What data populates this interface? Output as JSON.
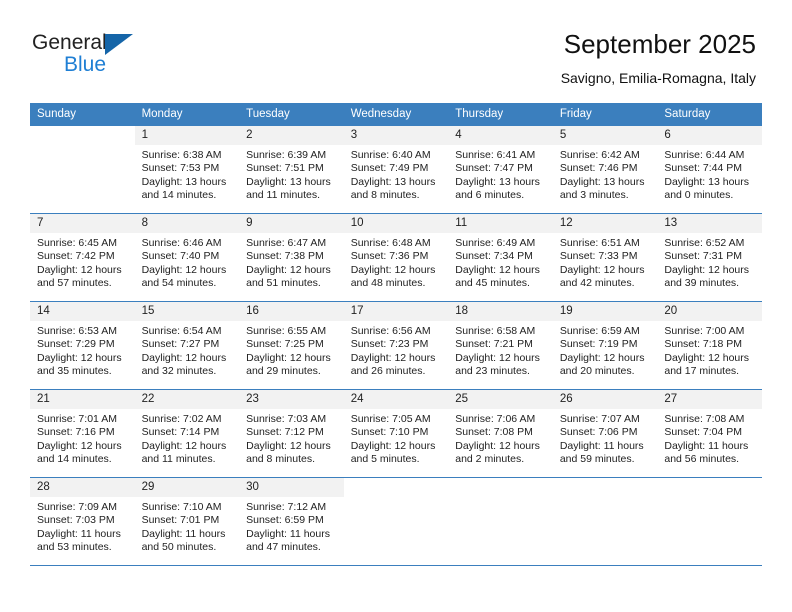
{
  "brand": {
    "name_part1": "General",
    "name_part2": "Blue",
    "triangle_icon": "triangle-icon",
    "accent_blue": "#1f7fd4",
    "header_blue": "#3b7fbe"
  },
  "header": {
    "title": "September 2025",
    "subtitle": "Savigno, Emilia-Romagna, Italy"
  },
  "weekday_headers": [
    "Sunday",
    "Monday",
    "Tuesday",
    "Wednesday",
    "Thursday",
    "Friday",
    "Saturday"
  ],
  "weeks": [
    [
      {
        "day": "",
        "empty": true
      },
      {
        "day": "1",
        "sunrise": "Sunrise: 6:38 AM",
        "sunset": "Sunset: 7:53 PM",
        "daylight": "Daylight: 13 hours and 14 minutes."
      },
      {
        "day": "2",
        "sunrise": "Sunrise: 6:39 AM",
        "sunset": "Sunset: 7:51 PM",
        "daylight": "Daylight: 13 hours and 11 minutes."
      },
      {
        "day": "3",
        "sunrise": "Sunrise: 6:40 AM",
        "sunset": "Sunset: 7:49 PM",
        "daylight": "Daylight: 13 hours and 8 minutes."
      },
      {
        "day": "4",
        "sunrise": "Sunrise: 6:41 AM",
        "sunset": "Sunset: 7:47 PM",
        "daylight": "Daylight: 13 hours and 6 minutes."
      },
      {
        "day": "5",
        "sunrise": "Sunrise: 6:42 AM",
        "sunset": "Sunset: 7:46 PM",
        "daylight": "Daylight: 13 hours and 3 minutes."
      },
      {
        "day": "6",
        "sunrise": "Sunrise: 6:44 AM",
        "sunset": "Sunset: 7:44 PM",
        "daylight": "Daylight: 13 hours and 0 minutes."
      }
    ],
    [
      {
        "day": "7",
        "sunrise": "Sunrise: 6:45 AM",
        "sunset": "Sunset: 7:42 PM",
        "daylight": "Daylight: 12 hours and 57 minutes."
      },
      {
        "day": "8",
        "sunrise": "Sunrise: 6:46 AM",
        "sunset": "Sunset: 7:40 PM",
        "daylight": "Daylight: 12 hours and 54 minutes."
      },
      {
        "day": "9",
        "sunrise": "Sunrise: 6:47 AM",
        "sunset": "Sunset: 7:38 PM",
        "daylight": "Daylight: 12 hours and 51 minutes."
      },
      {
        "day": "10",
        "sunrise": "Sunrise: 6:48 AM",
        "sunset": "Sunset: 7:36 PM",
        "daylight": "Daylight: 12 hours and 48 minutes."
      },
      {
        "day": "11",
        "sunrise": "Sunrise: 6:49 AM",
        "sunset": "Sunset: 7:34 PM",
        "daylight": "Daylight: 12 hours and 45 minutes."
      },
      {
        "day": "12",
        "sunrise": "Sunrise: 6:51 AM",
        "sunset": "Sunset: 7:33 PM",
        "daylight": "Daylight: 12 hours and 42 minutes."
      },
      {
        "day": "13",
        "sunrise": "Sunrise: 6:52 AM",
        "sunset": "Sunset: 7:31 PM",
        "daylight": "Daylight: 12 hours and 39 minutes."
      }
    ],
    [
      {
        "day": "14",
        "sunrise": "Sunrise: 6:53 AM",
        "sunset": "Sunset: 7:29 PM",
        "daylight": "Daylight: 12 hours and 35 minutes."
      },
      {
        "day": "15",
        "sunrise": "Sunrise: 6:54 AM",
        "sunset": "Sunset: 7:27 PM",
        "daylight": "Daylight: 12 hours and 32 minutes."
      },
      {
        "day": "16",
        "sunrise": "Sunrise: 6:55 AM",
        "sunset": "Sunset: 7:25 PM",
        "daylight": "Daylight: 12 hours and 29 minutes."
      },
      {
        "day": "17",
        "sunrise": "Sunrise: 6:56 AM",
        "sunset": "Sunset: 7:23 PM",
        "daylight": "Daylight: 12 hours and 26 minutes."
      },
      {
        "day": "18",
        "sunrise": "Sunrise: 6:58 AM",
        "sunset": "Sunset: 7:21 PM",
        "daylight": "Daylight: 12 hours and 23 minutes."
      },
      {
        "day": "19",
        "sunrise": "Sunrise: 6:59 AM",
        "sunset": "Sunset: 7:19 PM",
        "daylight": "Daylight: 12 hours and 20 minutes."
      },
      {
        "day": "20",
        "sunrise": "Sunrise: 7:00 AM",
        "sunset": "Sunset: 7:18 PM",
        "daylight": "Daylight: 12 hours and 17 minutes."
      }
    ],
    [
      {
        "day": "21",
        "sunrise": "Sunrise: 7:01 AM",
        "sunset": "Sunset: 7:16 PM",
        "daylight": "Daylight: 12 hours and 14 minutes."
      },
      {
        "day": "22",
        "sunrise": "Sunrise: 7:02 AM",
        "sunset": "Sunset: 7:14 PM",
        "daylight": "Daylight: 12 hours and 11 minutes."
      },
      {
        "day": "23",
        "sunrise": "Sunrise: 7:03 AM",
        "sunset": "Sunset: 7:12 PM",
        "daylight": "Daylight: 12 hours and 8 minutes."
      },
      {
        "day": "24",
        "sunrise": "Sunrise: 7:05 AM",
        "sunset": "Sunset: 7:10 PM",
        "daylight": "Daylight: 12 hours and 5 minutes."
      },
      {
        "day": "25",
        "sunrise": "Sunrise: 7:06 AM",
        "sunset": "Sunset: 7:08 PM",
        "daylight": "Daylight: 12 hours and 2 minutes."
      },
      {
        "day": "26",
        "sunrise": "Sunrise: 7:07 AM",
        "sunset": "Sunset: 7:06 PM",
        "daylight": "Daylight: 11 hours and 59 minutes."
      },
      {
        "day": "27",
        "sunrise": "Sunrise: 7:08 AM",
        "sunset": "Sunset: 7:04 PM",
        "daylight": "Daylight: 11 hours and 56 minutes."
      }
    ],
    [
      {
        "day": "28",
        "sunrise": "Sunrise: 7:09 AM",
        "sunset": "Sunset: 7:03 PM",
        "daylight": "Daylight: 11 hours and 53 minutes."
      },
      {
        "day": "29",
        "sunrise": "Sunrise: 7:10 AM",
        "sunset": "Sunset: 7:01 PM",
        "daylight": "Daylight: 11 hours and 50 minutes."
      },
      {
        "day": "30",
        "sunrise": "Sunrise: 7:12 AM",
        "sunset": "Sunset: 6:59 PM",
        "daylight": "Daylight: 11 hours and 47 minutes."
      },
      {
        "day": "",
        "empty": true
      },
      {
        "day": "",
        "empty": true
      },
      {
        "day": "",
        "empty": true
      },
      {
        "day": "",
        "empty": true
      }
    ]
  ]
}
